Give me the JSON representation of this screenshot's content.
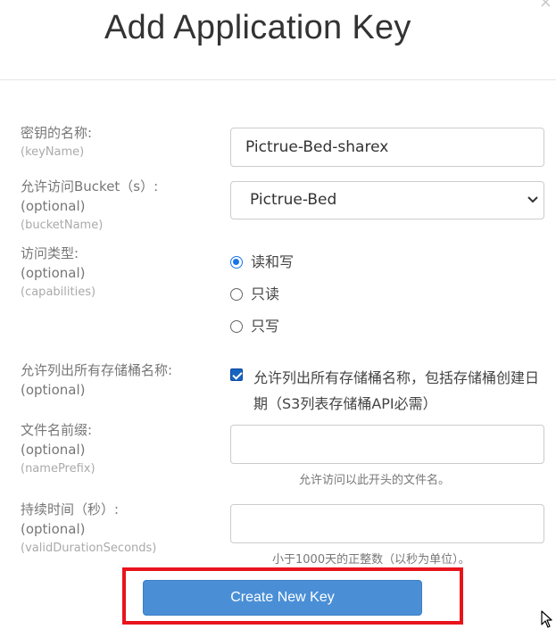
{
  "dialog": {
    "title": "Add Application Key",
    "close_glyph": "×"
  },
  "fields": {
    "key_name": {
      "label": "密钥的名称:",
      "key": "(keyName)",
      "value": "Pictrue-Bed-sharex"
    },
    "bucket": {
      "label": "允许访问Bucket（s）:",
      "optional": "(optional)",
      "key": "(bucketName)",
      "selected": "Pictrue-Bed"
    },
    "capabilities": {
      "label": "访问类型:",
      "optional": "(optional)",
      "key": "(capabilities)",
      "options": [
        "读和写",
        "只读",
        "只写"
      ],
      "selected_index": 0
    },
    "list_all": {
      "label": "允许列出所有存储桶名称:",
      "optional": "(optional)",
      "checked": true,
      "text": "允许列出所有存储桶名称，包括存储桶创建日期（S3列表存储桶API必需）"
    },
    "name_prefix": {
      "label": "文件名前缀:",
      "optional": "(optional)",
      "key": "(namePrefix)",
      "value": "",
      "hint": "允许访问以此开头的文件名。"
    },
    "duration": {
      "label": "持续时间（秒）:",
      "optional": "(optional)",
      "key": "(validDurationSeconds)",
      "value": "",
      "hint": "小于1000天的正整数（以秒为单位）。"
    }
  },
  "actions": {
    "create_label": "Create New Key"
  },
  "colors": {
    "primary_button": "#4a8fd6",
    "highlight_box": "#e8141c",
    "radio_checked": "#1a73e8",
    "checkbox": "#1565c0"
  },
  "icons": {
    "close": "close-icon",
    "select_arrow": "chevron-down-icon",
    "cursor": "mouse-pointer-icon"
  }
}
